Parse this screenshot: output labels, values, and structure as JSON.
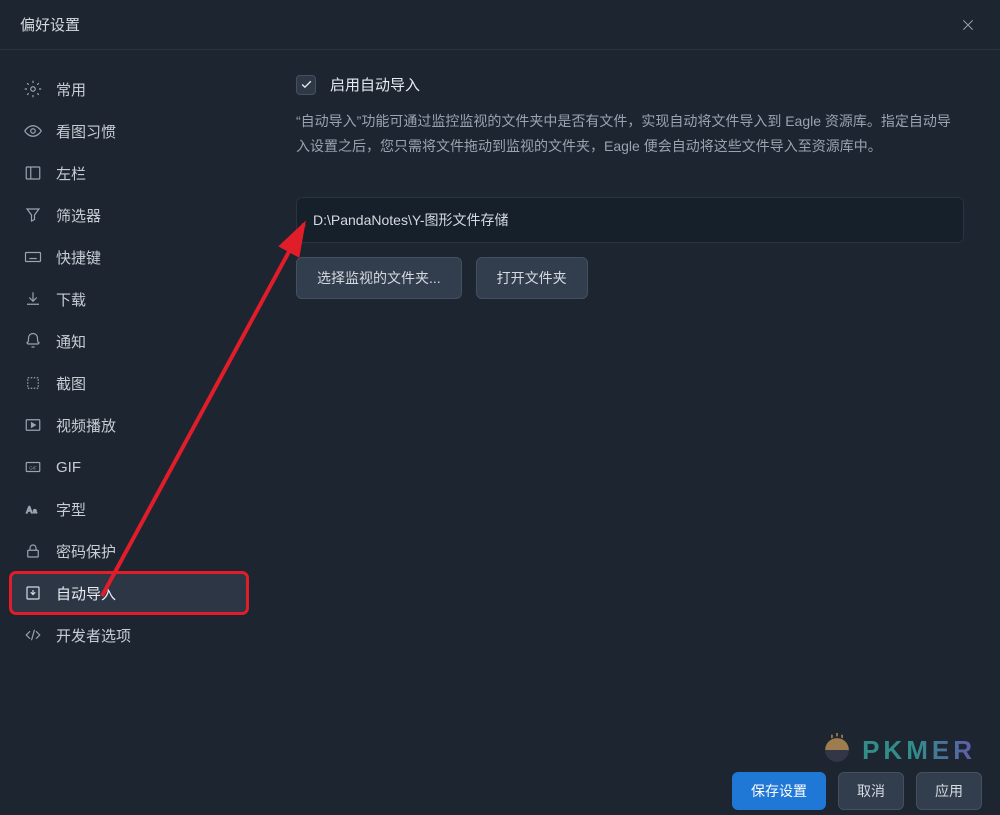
{
  "titlebar": {
    "title": "偏好设置"
  },
  "sidebar": {
    "items": [
      {
        "label": "常用"
      },
      {
        "label": "看图习惯"
      },
      {
        "label": "左栏"
      },
      {
        "label": "筛选器"
      },
      {
        "label": "快捷键"
      },
      {
        "label": "下载"
      },
      {
        "label": "通知"
      },
      {
        "label": "截图"
      },
      {
        "label": "视频播放"
      },
      {
        "label": "GIF"
      },
      {
        "label": "字型"
      },
      {
        "label": "密码保护"
      },
      {
        "label": "自动导入"
      },
      {
        "label": "开发者选项"
      }
    ]
  },
  "content": {
    "enable_label": "启用自动导入",
    "description": "“自动导入”功能可通过监控监视的文件夹中是否有文件，实现自动将文件导入到 Eagle 资源库。指定自动导入设置之后，您只需将文件拖动到监视的文件夹，Eagle 便会自动将这些文件导入至资源库中。",
    "path": "D:\\PandaNotes\\Y-图形文件存储",
    "choose_folder_label": "选择监视的文件夹...",
    "open_folder_label": "打开文件夹"
  },
  "footer": {
    "save_label": "保存设置",
    "cancel_label": "取消",
    "apply_label": "应用"
  },
  "watermark": {
    "text": "PKMER"
  }
}
